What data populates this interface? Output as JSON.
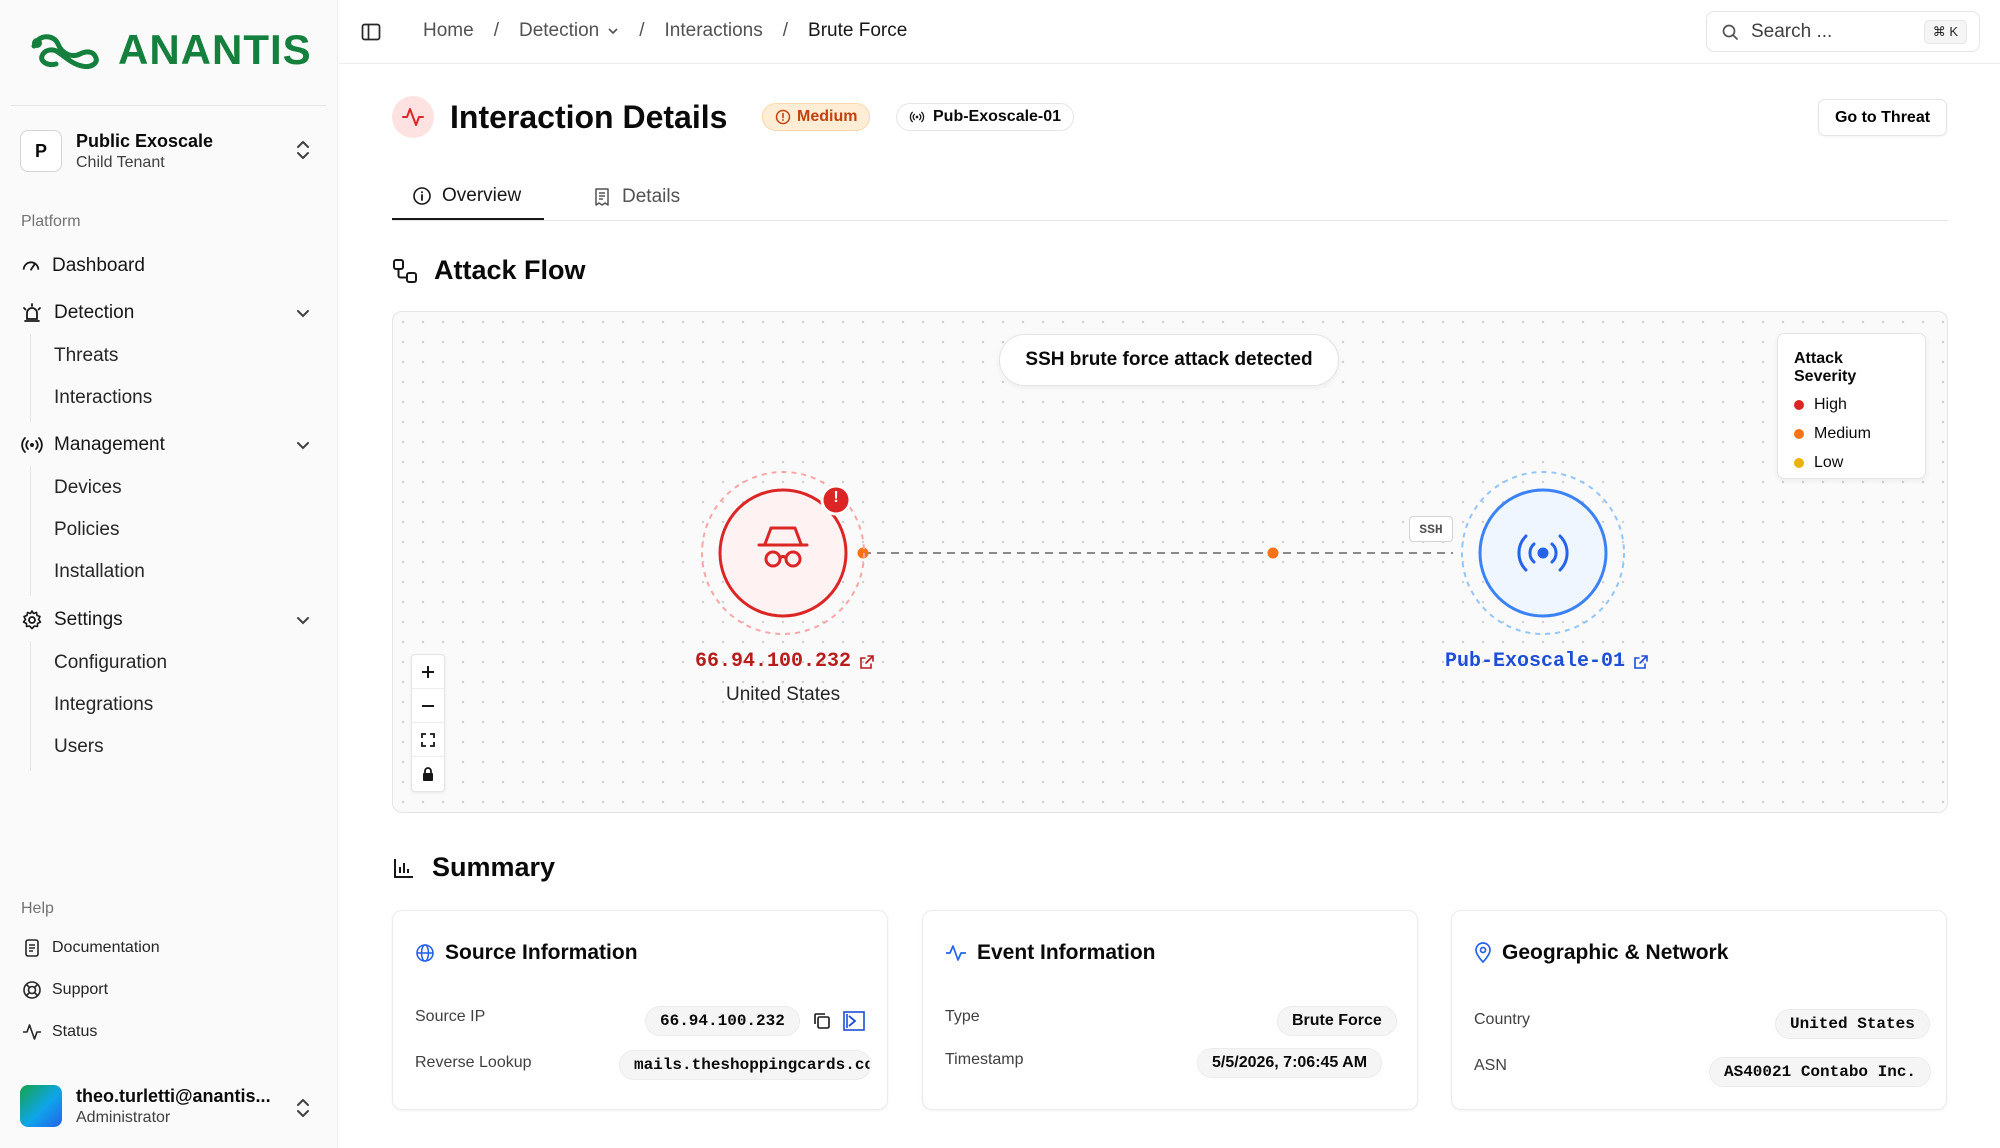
{
  "brand": {
    "name": "ANANTIS",
    "color": "#15803d"
  },
  "tenant": {
    "initial": "P",
    "name": "Public Exoscale",
    "subtitle": "Child Tenant"
  },
  "sidebar": {
    "platform_label": "Platform",
    "dashboard": "Dashboard",
    "detection": {
      "label": "Detection",
      "items": [
        "Threats",
        "Interactions"
      ]
    },
    "management": {
      "label": "Management",
      "items": [
        "Devices",
        "Policies",
        "Installation"
      ]
    },
    "settings": {
      "label": "Settings",
      "items": [
        "Configuration",
        "Integrations",
        "Users"
      ]
    },
    "help_label": "Help",
    "help_items": [
      "Documentation",
      "Support",
      "Status"
    ]
  },
  "user": {
    "name": "theo.turletti@anantis...",
    "role": "Administrator"
  },
  "breadcrumb": {
    "home": "Home",
    "detection": "Detection",
    "interactions": "Interactions",
    "current": "Brute Force"
  },
  "search": {
    "placeholder": "Search ...",
    "shortcut": "⌘ K"
  },
  "page": {
    "title": "Interaction Details",
    "severity": "Medium",
    "device": "Pub-Exoscale-01",
    "go_to_threat": "Go to Threat"
  },
  "tabs": {
    "overview": "Overview",
    "details": "Details"
  },
  "attack_flow": {
    "title": "Attack Flow",
    "banner": "SSH brute force attack detected",
    "legend": {
      "title": "Attack Severity",
      "items": [
        {
          "label": "High",
          "color": "#dc2626"
        },
        {
          "label": "Medium",
          "color": "#f97316"
        },
        {
          "label": "Low",
          "color": "#eab308"
        }
      ]
    },
    "source": {
      "ip": "66.94.100.232",
      "country": "United States",
      "alert": "!"
    },
    "target": {
      "name": "Pub-Exoscale-01"
    },
    "protocol": "SSH"
  },
  "summary": {
    "title": "Summary",
    "source_info": {
      "title": "Source Information",
      "source_ip_label": "Source IP",
      "source_ip": "66.94.100.232",
      "reverse_lookup_label": "Reverse Lookup",
      "reverse_lookup": "mails.theshoppingcards.co"
    },
    "event_info": {
      "title": "Event Information",
      "type_label": "Type",
      "type": "Brute Force",
      "timestamp_label": "Timestamp",
      "timestamp": "5/5/2026, 7:06:45 AM"
    },
    "geo": {
      "title": "Geographic & Network",
      "country_label": "Country",
      "country": "United States",
      "asn_label": "ASN",
      "asn": "AS40021 Contabo Inc."
    }
  }
}
